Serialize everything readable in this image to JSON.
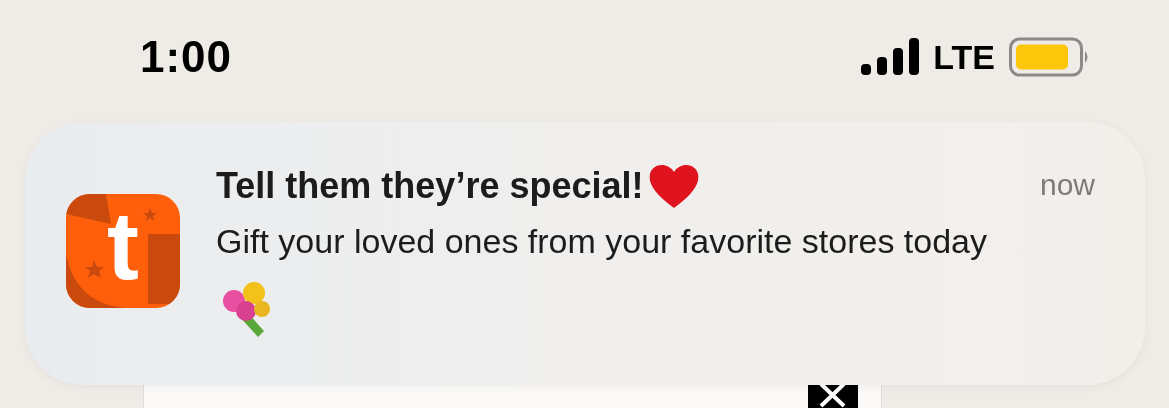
{
  "status_bar": {
    "time": "1:00",
    "network": "LTE"
  },
  "notification": {
    "app_icon": {
      "letter": "t"
    },
    "title": "Tell them they’re special!",
    "body": "Gift your loved ones from your favorite stores today",
    "time": "now"
  }
}
